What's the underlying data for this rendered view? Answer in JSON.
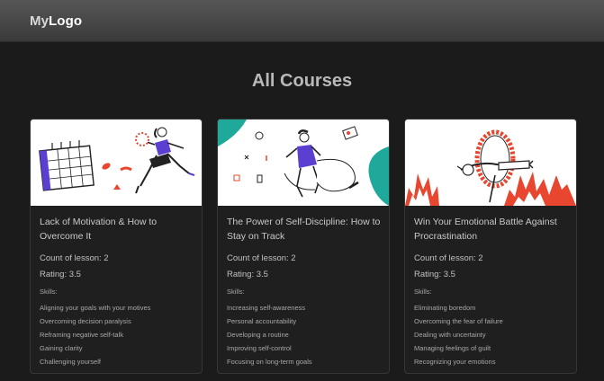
{
  "header": {
    "logo_my": "My",
    "logo_rest": "Logo"
  },
  "page": {
    "title": "All Courses"
  },
  "labels": {
    "count": "Count of lesson: ",
    "rating": "Rating: ",
    "skills": "Skills:"
  },
  "courses": [
    {
      "title": "Lack of Motivation & How to Overcome It",
      "lessons": "2",
      "rating": "3.5",
      "skills": [
        "Aligning your goals with your motives",
        "Overcoming decision paralysis",
        "Reframing negative self-talk",
        "Gaining clarity",
        "Challenging yourself"
      ],
      "illustration": "calendar-runner-illustration"
    },
    {
      "title": "The Power of Self-Discipline: How to Stay on Track",
      "lessons": "2",
      "rating": "3.5",
      "skills": [
        "Increasing self-awareness",
        "Personal accountability",
        "Developing a routine",
        "Improving self-control",
        "Focusing on long-term goals"
      ],
      "illustration": "woman-ticket-illustration"
    },
    {
      "title": "Win Your Emotional Battle Against Procrastination",
      "lessons": "2",
      "rating": "3.5",
      "skills": [
        "Eliminating boredom",
        "Overcoming the fear of failure",
        "Dealing with uncertainty",
        "Managing feelings of guilt",
        "Recognizing your emotions"
      ],
      "illustration": "fire-hoop-illustration"
    }
  ],
  "colors": {
    "accent_purple": "#5b3fd1",
    "accent_teal": "#1fa99b",
    "fire_red": "#e8462e",
    "background": "#1b1b1b"
  }
}
